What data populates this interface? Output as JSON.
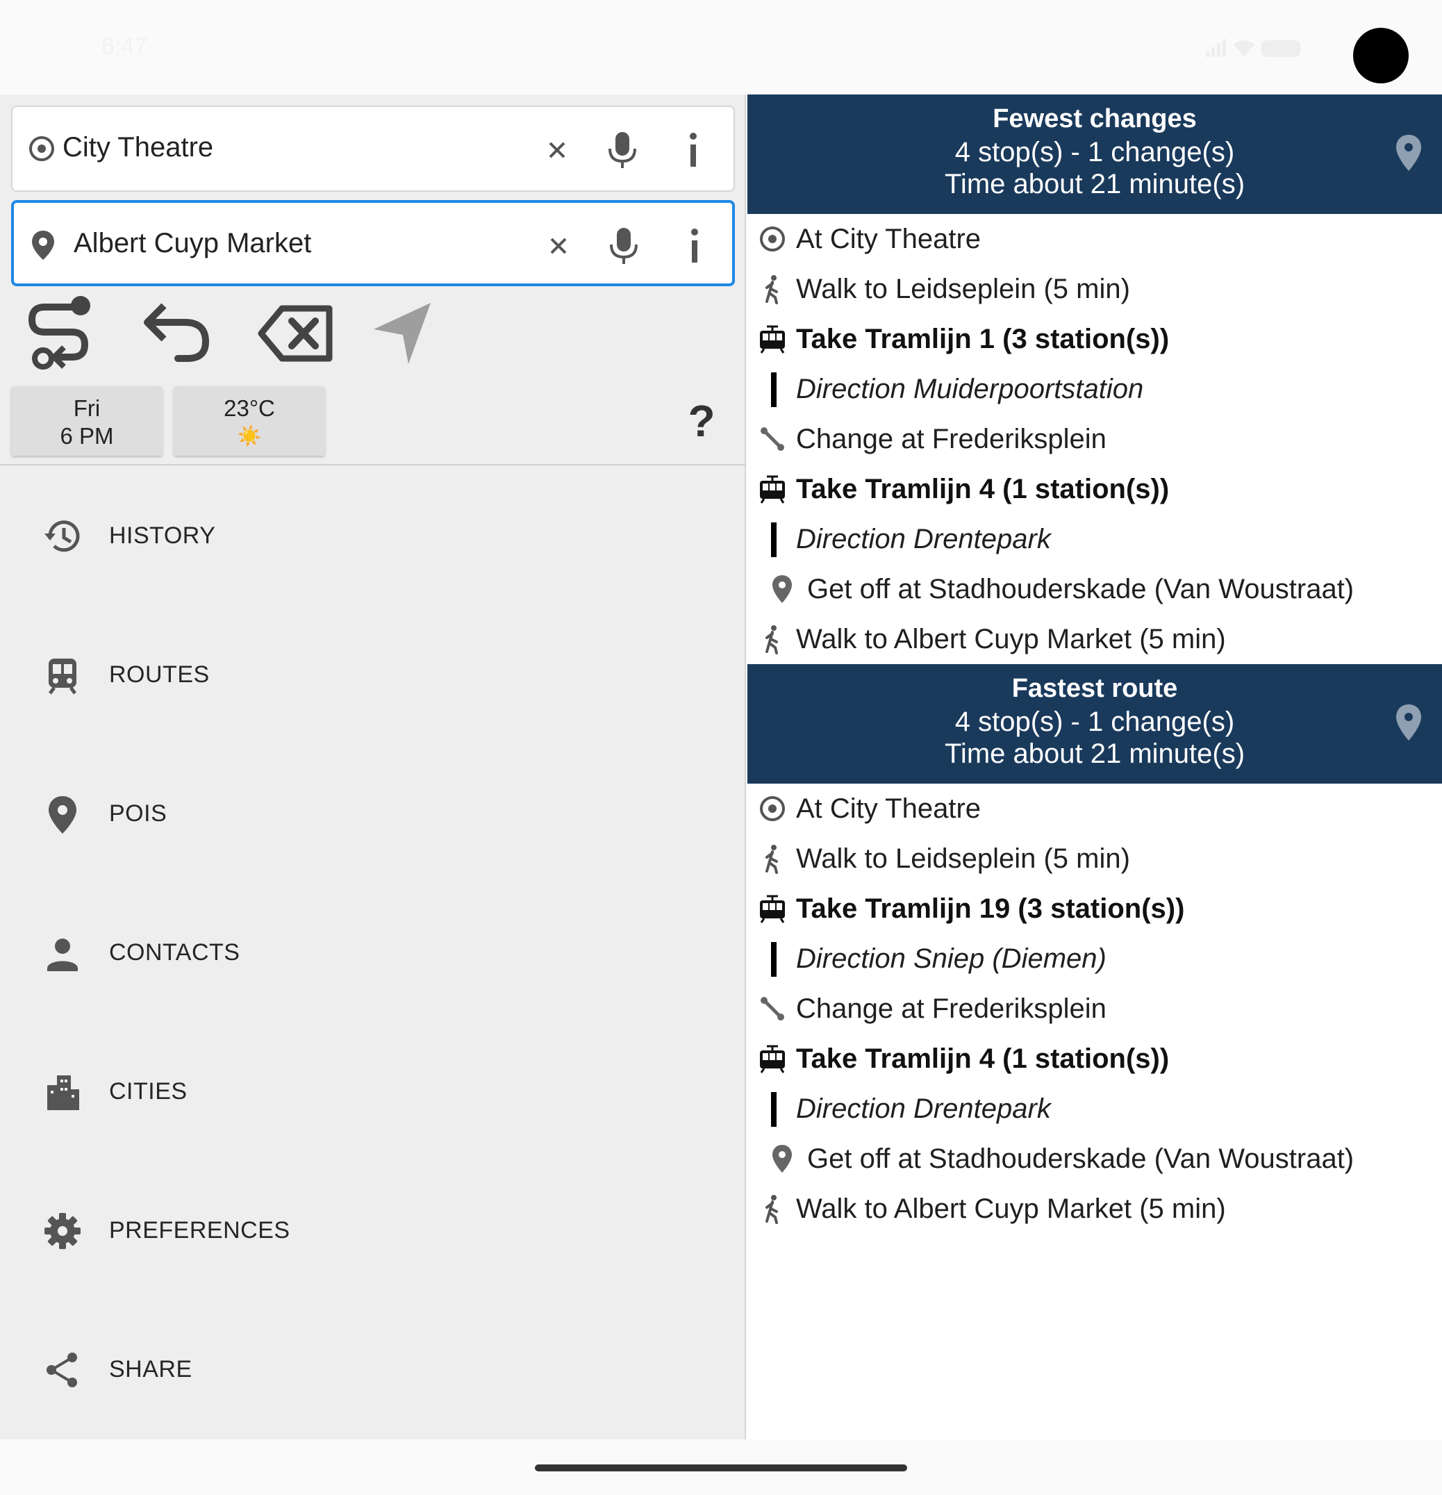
{
  "status_bar": {
    "time": "6:47"
  },
  "search": {
    "from": {
      "value": "City Theatre",
      "icon": "origin-target-icon"
    },
    "to": {
      "value": "Albert Cuyp Market",
      "icon": "location-pin-icon"
    }
  },
  "toolbar": {
    "buttons": [
      "route-plan-icon",
      "undo-icon",
      "backspace-icon",
      "navigate-icon"
    ]
  },
  "chips": {
    "datetime": {
      "day": "Fri",
      "time": "6 PM"
    },
    "weather": {
      "temp": "23°C",
      "icon": "☀️"
    },
    "help": "?"
  },
  "menu": [
    {
      "label": "HISTORY",
      "icon": "history-icon"
    },
    {
      "label": "ROUTES",
      "icon": "train-icon"
    },
    {
      "label": "POIS",
      "icon": "place-icon"
    },
    {
      "label": "CONTACTS",
      "icon": "person-icon"
    },
    {
      "label": "CITIES",
      "icon": "city-icon"
    },
    {
      "label": "PREFERENCES",
      "icon": "gear-icon"
    },
    {
      "label": "SHARE",
      "icon": "share-icon"
    }
  ],
  "routes": [
    {
      "title": "Fewest changes",
      "summary": "4 stop(s) - 1 change(s)",
      "time": "Time about 21 minute(s)",
      "steps": [
        {
          "type": "start",
          "text": "At City Theatre"
        },
        {
          "type": "walk",
          "text": "Walk to Leidseplein (5 min)"
        },
        {
          "type": "tram",
          "text": "Take Tramlijn 1 (3 station(s))"
        },
        {
          "type": "direction",
          "text": "Direction Muiderpoortstation"
        },
        {
          "type": "change",
          "text": "Change at Frederiksplein"
        },
        {
          "type": "tram",
          "text": "Take Tramlijn 4 (1 station(s))"
        },
        {
          "type": "direction",
          "text": "Direction Drentepark"
        },
        {
          "type": "getoff",
          "text": "Get off at Stadhouderskade (Van Woustraat)"
        },
        {
          "type": "walk",
          "text": "Walk to Albert Cuyp Market (5 min)"
        }
      ]
    },
    {
      "title": "Fastest route",
      "summary": "4 stop(s) - 1 change(s)",
      "time": "Time about 21 minute(s)",
      "steps": [
        {
          "type": "start",
          "text": "At City Theatre"
        },
        {
          "type": "walk",
          "text": "Walk to Leidseplein (5 min)"
        },
        {
          "type": "tram",
          "text": "Take Tramlijn 19 (3 station(s))"
        },
        {
          "type": "direction",
          "text": "Direction Sniep (Diemen)"
        },
        {
          "type": "change",
          "text": "Change at Frederiksplein"
        },
        {
          "type": "tram",
          "text": "Take Tramlijn 4 (1 station(s))"
        },
        {
          "type": "direction",
          "text": "Direction Drentepark"
        },
        {
          "type": "getoff",
          "text": "Get off at Stadhouderskade (Van Woustraat)"
        },
        {
          "type": "walk",
          "text": "Walk to Albert Cuyp Market (5 min)"
        }
      ]
    }
  ],
  "colors": {
    "header_bg": "#1a3a5c",
    "focus_border": "#1e88e5",
    "pane_bg": "#eeeeee"
  }
}
